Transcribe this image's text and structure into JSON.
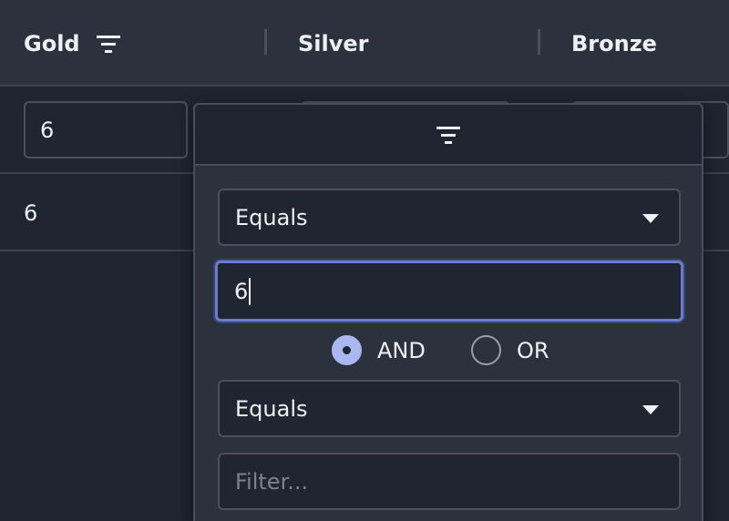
{
  "columns": {
    "gold": "Gold",
    "silver": "Silver",
    "bronze": "Bronze"
  },
  "floating_filters": {
    "gold_value": "6",
    "silver_value": "",
    "bronze_value": ""
  },
  "rows": [
    {
      "gold": "6"
    }
  ],
  "filter_popup": {
    "condition1": {
      "type": "Equals",
      "value": "6"
    },
    "join_operator": {
      "and_label": "AND",
      "or_label": "OR",
      "selected": "AND"
    },
    "condition2": {
      "type": "Equals",
      "value": "",
      "placeholder": "Filter..."
    }
  },
  "icons": {
    "column_menu": "filter-menu-icon",
    "popup_tab": "filter-tab-icon",
    "select_arrow": "chevron-down-icon"
  },
  "colors": {
    "accent": "#aab7f0",
    "focus_border": "#6b7cd0",
    "background": "#1f2531",
    "header_background": "#2b313d"
  }
}
